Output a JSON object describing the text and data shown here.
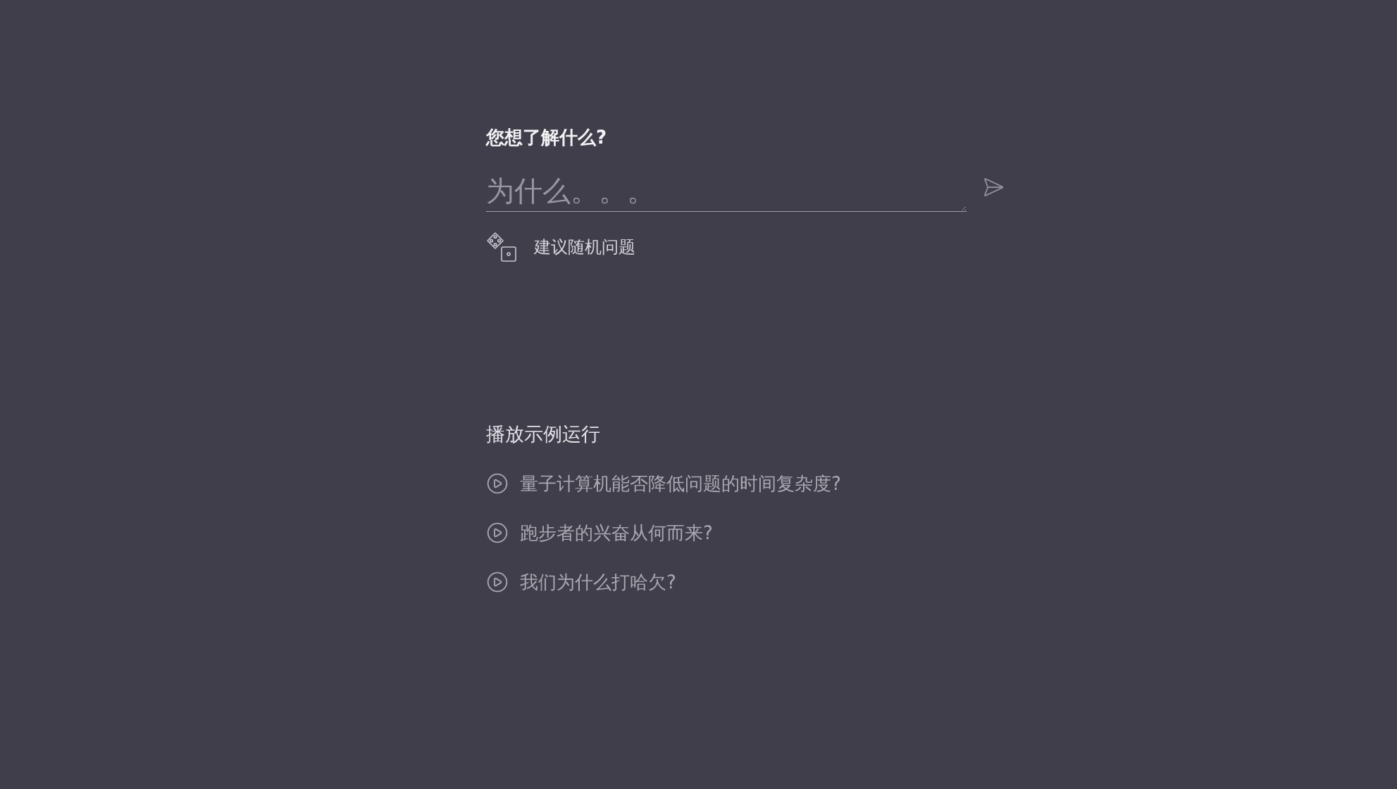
{
  "prompt": {
    "title": "您想了解什么?"
  },
  "question_input": {
    "placeholder": "为什么。。。"
  },
  "random_question_button": {
    "label": "建议随机问题"
  },
  "examples": {
    "title": "播放示例运行",
    "items": [
      {
        "label": "量子计算机能否降低问题的时间复杂度?"
      },
      {
        "label": "跑步者的兴奋从何而来?"
      },
      {
        "label": "我们为什么打哈欠?"
      }
    ]
  }
}
